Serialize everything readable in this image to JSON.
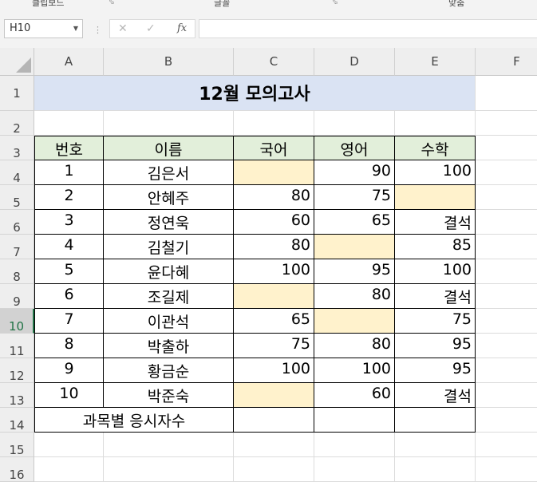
{
  "ribbon": {
    "groups": [
      "클립보드",
      "글꼴",
      "맞춤"
    ]
  },
  "formula_bar": {
    "name_box": "H10",
    "fx_label": "fx",
    "formula": ""
  },
  "columns": [
    "A",
    "B",
    "C",
    "D",
    "E",
    "F"
  ],
  "rows": [
    "1",
    "2",
    "3",
    "4",
    "5",
    "6",
    "7",
    "8",
    "9",
    "10",
    "11",
    "12",
    "13",
    "14",
    "15",
    "16"
  ],
  "selected_row": "10",
  "sheet": {
    "title": "12월 모의고사",
    "headers": [
      "번호",
      "이름",
      "국어",
      "영어",
      "수학"
    ],
    "students": [
      {
        "no": "1",
        "name": "김은서",
        "kor": "",
        "eng": "90",
        "math": "100"
      },
      {
        "no": "2",
        "name": "안혜주",
        "kor": "80",
        "eng": "75",
        "math": ""
      },
      {
        "no": "3",
        "name": "정연욱",
        "kor": "60",
        "eng": "65",
        "math": "결석"
      },
      {
        "no": "4",
        "name": "김철기",
        "kor": "80",
        "eng": "",
        "math": "85"
      },
      {
        "no": "5",
        "name": "윤다혜",
        "kor": "100",
        "eng": "95",
        "math": "100"
      },
      {
        "no": "6",
        "name": "조길제",
        "kor": "",
        "eng": "80",
        "math": "결석"
      },
      {
        "no": "7",
        "name": "이관석",
        "kor": "65",
        "eng": "",
        "math": "75"
      },
      {
        "no": "8",
        "name": "박출하",
        "kor": "75",
        "eng": "80",
        "math": "95"
      },
      {
        "no": "9",
        "name": "황금순",
        "kor": "100",
        "eng": "100",
        "math": "95"
      },
      {
        "no": "10",
        "name": "박준숙",
        "kor": "",
        "eng": "60",
        "math": "결석"
      }
    ],
    "summary_label": "과목별 응시자수"
  },
  "colors": {
    "title_fill": "#dae3f3",
    "header_fill": "#e2efda",
    "empty_fill": "#fff2cc",
    "selection": "#217346"
  }
}
